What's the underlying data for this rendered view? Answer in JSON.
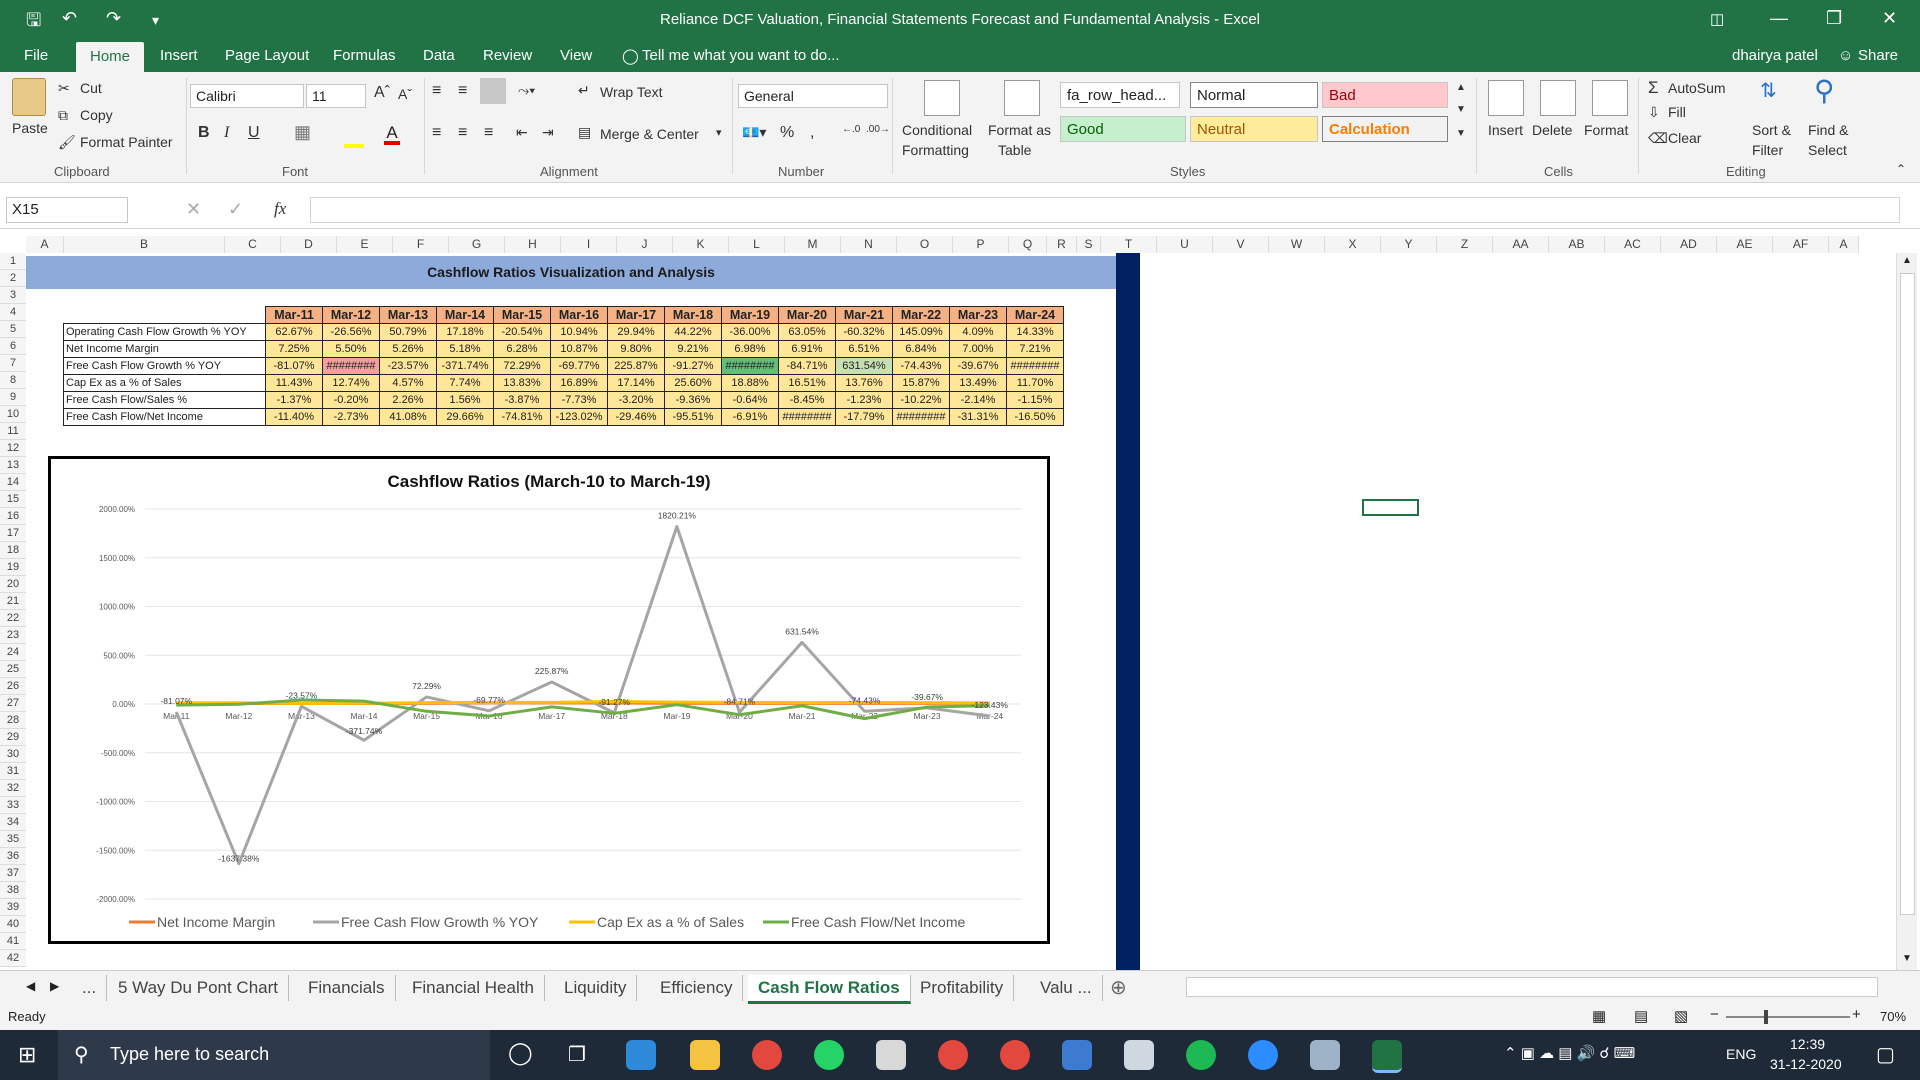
{
  "window": {
    "title": "Reliance DCF Valuation, Financial Statements Forecast and Fundamental Analysis  -  Excel"
  },
  "ribbon_tabs": [
    "File",
    "Home",
    "Insert",
    "Page Layout",
    "Formulas",
    "Data",
    "Review",
    "View"
  ],
  "tell_me": "Tell me what you want to do...",
  "user": "dhairya patel",
  "share": "Share",
  "clipboard": {
    "paste": "Paste",
    "cut": "Cut",
    "copy": "Copy",
    "format_painter": "Format Painter",
    "label": "Clipboard"
  },
  "font": {
    "name": "Calibri",
    "size": "11",
    "label": "Font"
  },
  "alignment": {
    "wrap": "Wrap Text",
    "merge": "Merge & Center",
    "label": "Alignment"
  },
  "number": {
    "format": "General",
    "label": "Number"
  },
  "styles": {
    "conditional": "Conditional",
    "formatting": "Formatting",
    "format_as": "Format as",
    "table": "Table",
    "cell1": "fa_row_head...",
    "normal": "Normal",
    "bad": "Bad",
    "good": "Good",
    "neutral": "Neutral",
    "calculation": "Calculation",
    "label": "Styles"
  },
  "cells": {
    "insert": "Insert",
    "delete": "Delete",
    "format": "Format",
    "label": "Cells"
  },
  "editing": {
    "autosum": "AutoSum",
    "fill": "Fill",
    "clear": "Clear",
    "sort": "Sort &",
    "filter": "Filter",
    "find": "Find &",
    "select": "Select",
    "label": "Editing"
  },
  "formula_bar": {
    "name_box": "X15",
    "fx": "fx",
    "value": ""
  },
  "columns": [
    "A",
    "B",
    "C",
    "D",
    "E",
    "F",
    "G",
    "H",
    "I",
    "J",
    "K",
    "L",
    "M",
    "N",
    "O",
    "P",
    "Q",
    "R",
    "S",
    "T",
    "U",
    "V",
    "W",
    "X",
    "Y",
    "Z",
    "AA",
    "AB",
    "AC",
    "AD",
    "AE",
    "AF",
    "A"
  ],
  "rows": [
    "1",
    "2",
    "3",
    "4",
    "5",
    "6",
    "7",
    "8",
    "9",
    "10",
    "11",
    "12",
    "13",
    "14",
    "15",
    "16",
    "17",
    "18",
    "19",
    "20",
    "21",
    "22",
    "23",
    "24",
    "25",
    "26",
    "27",
    "28",
    "29",
    "30",
    "31",
    "32",
    "33",
    "34",
    "35",
    "36",
    "37",
    "38",
    "39",
    "40",
    "41",
    "42"
  ],
  "sheet_title": "Cashflow Ratios Visualization and Analysis",
  "table": {
    "headers": [
      "Mar-11",
      "Mar-12",
      "Mar-13",
      "Mar-14",
      "Mar-15",
      "Mar-16",
      "Mar-17",
      "Mar-18",
      "Mar-19",
      "Mar-20",
      "Mar-21",
      "Mar-22",
      "Mar-23",
      "Mar-24"
    ],
    "rows": [
      {
        "label": "Operating Cash Flow Growth % YOY",
        "values": [
          "62.67%",
          "-26.56%",
          "50.79%",
          "17.18%",
          "-20.54%",
          "10.94%",
          "29.94%",
          "44.22%",
          "-36.00%",
          "63.05%",
          "-60.32%",
          "145.09%",
          "4.09%",
          "14.33%"
        ]
      },
      {
        "label": "Net Income Margin",
        "values": [
          "7.25%",
          "5.50%",
          "5.26%",
          "5.18%",
          "6.28%",
          "10.87%",
          "9.80%",
          "9.21%",
          "6.98%",
          "6.91%",
          "6.51%",
          "6.84%",
          "7.00%",
          "7.21%"
        ]
      },
      {
        "label": "Free Cash Flow Growth % YOY",
        "values": [
          "-81.07%",
          "########",
          "-23.57%",
          "-371.74%",
          "72.29%",
          "-69.77%",
          "225.87%",
          "-91.27%",
          "########",
          "-84.71%",
          "631.54%",
          "-74.43%",
          "-39.67%",
          "########"
        ]
      },
      {
        "label": "Cap Ex as a % of Sales",
        "values": [
          "11.43%",
          "12.74%",
          "4.57%",
          "7.74%",
          "13.83%",
          "16.89%",
          "17.14%",
          "25.60%",
          "18.88%",
          "16.51%",
          "13.76%",
          "15.87%",
          "13.49%",
          "11.70%"
        ]
      },
      {
        "label": "Free Cash Flow/Sales %",
        "values": [
          "-1.37%",
          "-0.20%",
          "2.26%",
          "1.56%",
          "-3.87%",
          "-7.73%",
          "-3.20%",
          "-9.36%",
          "-0.64%",
          "-8.45%",
          "-1.23%",
          "-10.22%",
          "-2.14%",
          "-1.15%"
        ]
      },
      {
        "label": "Free Cash Flow/Net Income",
        "values": [
          "-11.40%",
          "-2.73%",
          "41.08%",
          "29.66%",
          "-74.81%",
          "-123.02%",
          "-29.46%",
          "-95.51%",
          "-6.91%",
          "########",
          "-17.79%",
          "########",
          "-31.31%",
          "-16.50%"
        ]
      }
    ]
  },
  "chart_data": {
    "type": "line",
    "title": "Cashflow Ratios  (March-10 to March-19)",
    "categories": [
      "Mar-11",
      "Mar-12",
      "Mar-13",
      "Mar-14",
      "Mar-15",
      "Mar-16",
      "Mar-17",
      "Mar-18",
      "Mar-19",
      "Mar-20",
      "Mar-21",
      "Mar-22",
      "Mar-23",
      "Mar-24"
    ],
    "ylim": [
      -2000,
      2000
    ],
    "yticks": [
      "2000.00%",
      "1500.00%",
      "1000.00%",
      "500.00%",
      "0.00%",
      "-500.00%",
      "-1000.00%",
      "-1500.00%",
      "-2000.00%"
    ],
    "ytick_values": [
      2000,
      1500,
      1000,
      500,
      0,
      -500,
      -1000,
      -1500,
      -2000
    ],
    "legend_position": "bottom",
    "series": [
      {
        "name": "Net Income Margin",
        "color": "#ed7d31",
        "values": [
          7.25,
          5.5,
          5.26,
          5.18,
          6.28,
          10.87,
          9.8,
          9.21,
          6.98,
          6.91,
          6.51,
          6.84,
          7.0,
          7.21
        ]
      },
      {
        "name": "Free Cash Flow Growth % YOY",
        "color": "#a5a5a5",
        "values": [
          -81.07,
          -1637.38,
          -23.57,
          -371.74,
          72.29,
          -69.77,
          225.87,
          -91.27,
          1820.21,
          -84.71,
          631.54,
          -74.43,
          -39.67,
          -123.43
        ],
        "labels": [
          "-81.07%",
          "-1637.38%",
          "-23.57%",
          "-371.74%",
          "72.29%",
          "-69.77%",
          "225.87%",
          "-91.27%",
          "1820.21%",
          "-84.71%",
          "631.54%",
          "-74.43%",
          "-39.67%",
          "-123.43%"
        ]
      },
      {
        "name": "Cap Ex as a % of Sales",
        "color": "#ffc000",
        "values": [
          11.43,
          12.74,
          4.57,
          7.74,
          13.83,
          16.89,
          17.14,
          25.6,
          18.88,
          16.51,
          13.76,
          15.87,
          13.49,
          11.7
        ]
      },
      {
        "name": "Free Cash Flow/Net Income",
        "color": "#70ad47",
        "values": [
          -11.4,
          -2.73,
          41.08,
          29.66,
          -74.81,
          -123.02,
          -29.46,
          -95.51,
          -6.91,
          -110,
          -17.79,
          -150,
          -31.31,
          -16.5
        ]
      }
    ]
  },
  "sheet_tabs": [
    "...",
    "5 Way Du Pont Chart",
    "Financials",
    "Financial Health",
    "Liquidity",
    "Efficiency",
    "Cash Flow Ratios",
    "Profitability",
    "Valu ..."
  ],
  "status": {
    "ready": "Ready",
    "zoom": "70%"
  },
  "taskbar": {
    "search": "Type here to search",
    "lang": "ENG",
    "time": "12:39",
    "date": "31-12-2020"
  }
}
